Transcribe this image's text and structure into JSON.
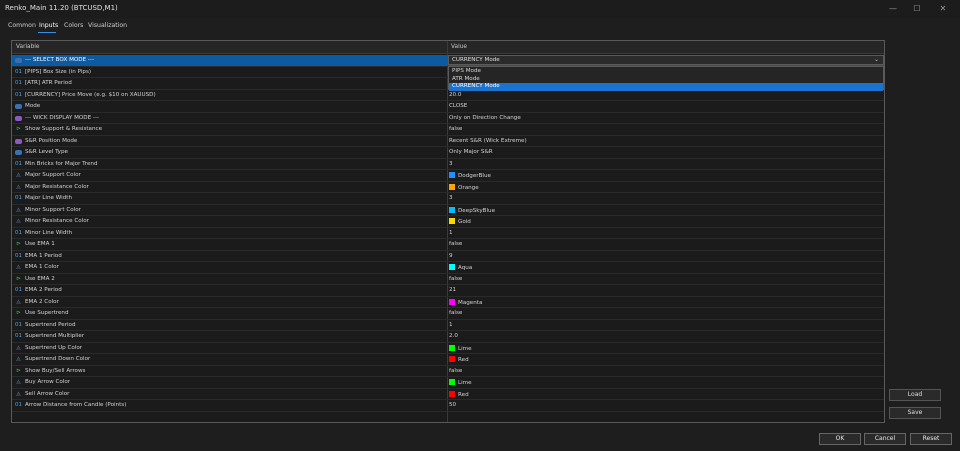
{
  "window": {
    "title": "Renko_Main 11.20 (BTCUSD,M1)",
    "minimize_glyph": "—",
    "maximize_glyph": "☐",
    "close_glyph": "✕"
  },
  "tabs": [
    "Common",
    "Inputs",
    "Colors",
    "Visualization"
  ],
  "active_tab": "Inputs",
  "table": {
    "col_variable": "Variable",
    "col_value": "Value",
    "rows": [
      {
        "label": "--- SELECT BOX MODE ---",
        "value": "CURRENCY Mode",
        "icon": "enum-icon",
        "selected": true
      },
      {
        "label": "[PIPS] Box Size (in Pips)",
        "value": "",
        "icon": "number-icon"
      },
      {
        "label": "[ATR] ATR Period",
        "value": "",
        "icon": "number-icon"
      },
      {
        "label": "[CURRENCY] Price Move (e.g. $10 on XAUUSD)",
        "value": "20.0",
        "icon": "number-icon"
      },
      {
        "label": "Mode",
        "value": "CLOSE",
        "icon": "enum-icon"
      },
      {
        "label": "--- WICK DISPLAY MODE ---",
        "value": "Only on Direction Change",
        "icon": "separator-icon"
      },
      {
        "label": "Show Support & Resistance",
        "value": "false",
        "icon": "bool-icon"
      },
      {
        "label": "S&R Position Mode",
        "value": "Recent S&R (Wick Extreme)",
        "icon": "separator-icon"
      },
      {
        "label": "S&R Level Type",
        "value": "Only Major S&R",
        "icon": "enum-icon"
      },
      {
        "label": "Min Bricks for Major Trend",
        "value": "3",
        "icon": "number-icon"
      },
      {
        "label": "Major Support Color",
        "value": "DodgerBlue",
        "icon": "color-icon",
        "swatch": "#1e90ff"
      },
      {
        "label": "Major Resistance Color",
        "value": "Orange",
        "icon": "color-icon",
        "swatch": "#ffa500"
      },
      {
        "label": "Major Line Width",
        "value": "3",
        "icon": "number-icon"
      },
      {
        "label": "Minor Support Color",
        "value": "DeepSkyBlue",
        "icon": "color-icon",
        "swatch": "#00bfff"
      },
      {
        "label": "Minor Resistance Color",
        "value": "Gold",
        "icon": "color-icon",
        "swatch": "#ffd700"
      },
      {
        "label": "Minor Line Width",
        "value": "1",
        "icon": "number-icon"
      },
      {
        "label": "Use EMA 1",
        "value": "false",
        "icon": "bool-icon"
      },
      {
        "label": "EMA 1 Period",
        "value": "9",
        "icon": "number-icon"
      },
      {
        "label": "EMA 1 Color",
        "value": "Aqua",
        "icon": "color-icon",
        "swatch": "#00ffff"
      },
      {
        "label": "Use EMA 2",
        "value": "false",
        "icon": "bool-icon"
      },
      {
        "label": "EMA 2 Period",
        "value": "21",
        "icon": "number-icon"
      },
      {
        "label": "EMA 2 Color",
        "value": "Magenta",
        "icon": "color-icon",
        "swatch": "#ff00ff"
      },
      {
        "label": "Use Supertrend",
        "value": "false",
        "icon": "bool-icon"
      },
      {
        "label": "Supertrend Period",
        "value": "1",
        "icon": "number-icon"
      },
      {
        "label": "Supertrend Multiplier",
        "value": "2.0",
        "icon": "number-icon"
      },
      {
        "label": "Supertrend Up Color",
        "value": "Lime",
        "icon": "color-icon",
        "swatch": "#00ff00"
      },
      {
        "label": "Supertrend Down Color",
        "value": "Red",
        "icon": "color-icon",
        "swatch": "#ff0000"
      },
      {
        "label": "Show Buy/Sell Arrows",
        "value": "false",
        "icon": "bool-icon"
      },
      {
        "label": "Buy Arrow Color",
        "value": "Lime",
        "icon": "color-icon",
        "swatch": "#00ff00"
      },
      {
        "label": "Sell Arrow Color",
        "value": "Red",
        "icon": "color-icon",
        "swatch": "#ff0000"
      },
      {
        "label": "Arrow Distance from Candle (Points)",
        "value": "50",
        "icon": "number-icon"
      }
    ]
  },
  "dropdown": {
    "value": "CURRENCY Mode",
    "chevron": "⌄",
    "options": [
      "PIPS Mode",
      "ATR Mode",
      "CURRENCY Mode"
    ],
    "selected_index": 2
  },
  "side_buttons": {
    "load": "Load",
    "save": "Save"
  },
  "bottom_buttons": {
    "ok": "OK",
    "cancel": "Cancel",
    "reset": "Reset"
  },
  "colors": {
    "accent": "#1a73d1",
    "selected_row": "#0e5aa0"
  }
}
